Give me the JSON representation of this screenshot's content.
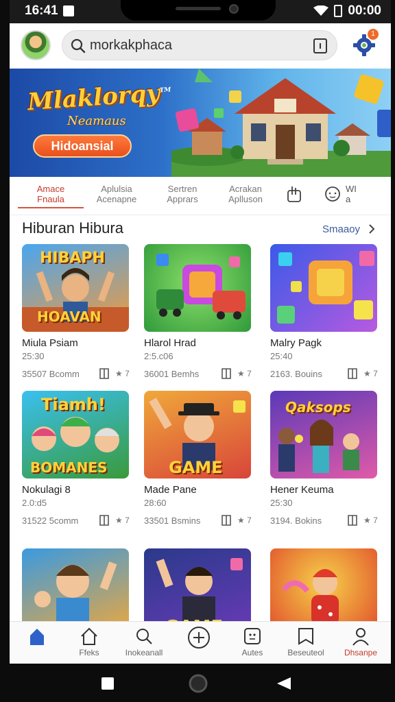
{
  "status": {
    "time": "16:41",
    "clock": "00:00"
  },
  "header": {
    "search_value": "morkakphaca",
    "gear_badge": "1"
  },
  "banner": {
    "title": "Mlaklorqy",
    "title_mark": "TM",
    "subtitle": "Neamaus",
    "button": "Hidoansial"
  },
  "tabs": [
    {
      "line1": "Amace",
      "line2": "Fnaula"
    },
    {
      "line1": "Aplulsia",
      "line2": "Acenapne"
    },
    {
      "line1": "Sertren",
      "line2": "Apprars"
    },
    {
      "line1": "Acrakan",
      "line2": "Aplluson"
    }
  ],
  "tab_extra": {
    "line1": "WI",
    "line2": "a"
  },
  "section": {
    "title": "Hiburan Hibura",
    "more": "Smaaoy"
  },
  "games": [
    {
      "name": "Miula Psiam",
      "sub": "25:30",
      "downloads": "35507 Bcomm",
      "rating": "★ 7",
      "thumb_text_top": "HIBAPH",
      "thumb_text_bottom": "HOAVAN"
    },
    {
      "name": "Hlarol Hrad",
      "sub": "2:5.c06",
      "downloads": "36001 Bemhs",
      "rating": "★ 7"
    },
    {
      "name": "Malry Pagk",
      "sub": "25:40",
      "downloads": "2163. Bouins",
      "rating": "★ 7"
    },
    {
      "name": "Nokulagi 8",
      "sub": "2.0:d5",
      "downloads": "31522 5comm",
      "rating": "★ 7",
      "thumb_text_top": "Tiamh!",
      "thumb_text_bottom": "BOMANES"
    },
    {
      "name": "Made Pane",
      "sub": "28:60",
      "downloads": "33501 Bsmins",
      "rating": "★ 7",
      "thumb_text_bottom": "GAME"
    },
    {
      "name": "Hener Keuma",
      "sub": "25:30",
      "downloads": "3194. Bokins",
      "rating": "★ 7",
      "thumb_text_top": "Qaksops"
    },
    {
      "name": "",
      "sub": "",
      "downloads": "",
      "rating": ""
    },
    {
      "name": "",
      "sub": "",
      "downloads": "",
      "rating": "",
      "thumb_text_bottom": "GAME"
    },
    {
      "name": "",
      "sub": "",
      "downloads": "",
      "rating": ""
    }
  ],
  "nav": [
    {
      "label": "",
      "icon": "home-icon"
    },
    {
      "label": "Ffeks",
      "icon": "house-outline-icon"
    },
    {
      "label": "Inokeanall",
      "icon": "search-icon"
    },
    {
      "label": "",
      "icon": "plus-circle-icon"
    },
    {
      "label": "Autes",
      "icon": "apps-icon"
    },
    {
      "label": "Beseuteol",
      "icon": "bookmark-icon"
    },
    {
      "label": "Dhsanpe",
      "icon": "profile-icon"
    }
  ],
  "colors": {
    "accent": "#c43a2a",
    "link": "#3a5b9a",
    "nav_home": "#2f62c8"
  }
}
